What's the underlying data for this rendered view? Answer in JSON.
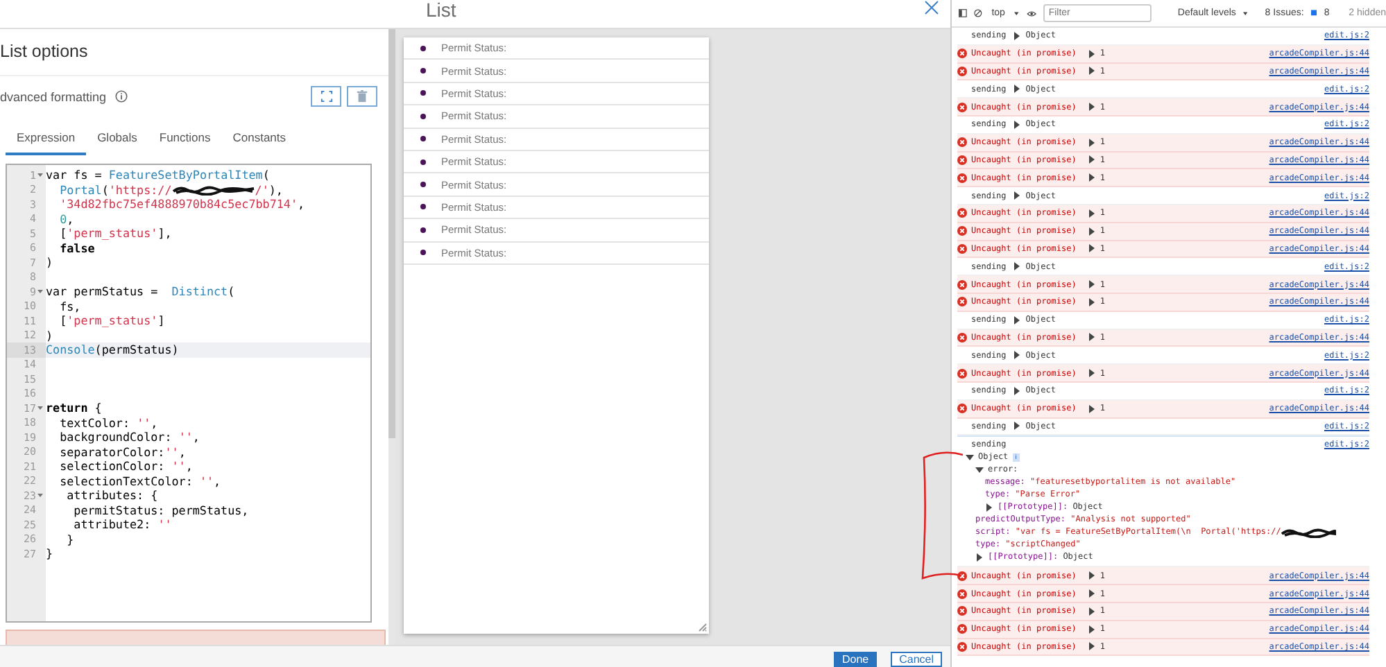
{
  "dialog": {
    "title": "List",
    "footer_buttons": [
      {
        "label": "Done",
        "kind": "primary"
      },
      {
        "label": "Cancel",
        "kind": "secondary"
      }
    ]
  },
  "options_panel": {
    "title": "List options",
    "section_label": "dvanced formatting",
    "tabs": [
      {
        "label": "Expression",
        "selected": true
      },
      {
        "label": "Globals",
        "selected": false
      },
      {
        "label": "Functions",
        "selected": false
      },
      {
        "label": "Constants",
        "selected": false
      }
    ]
  },
  "editor": {
    "lines": [
      {
        "number": "1",
        "foldable": true,
        "current": false,
        "tokens": [
          {
            "text": "var fs = ",
            "kind": "plain"
          },
          {
            "text": "FeatureSetByPortalItem",
            "kind": "function"
          },
          {
            "text": "(",
            "kind": "plain"
          }
        ]
      },
      {
        "number": "2",
        "foldable": false,
        "current": false,
        "tokens": [
          {
            "text": "  Portal",
            "kind": "function"
          },
          {
            "text": "(",
            "kind": "plain"
          },
          {
            "text": "'https://",
            "kind": "string"
          },
          {
            "kind": "redaction"
          },
          {
            "text": "/'",
            "kind": "string"
          },
          {
            "text": "),",
            "kind": "plain"
          }
        ]
      },
      {
        "number": "3",
        "foldable": false,
        "current": false,
        "tokens": [
          {
            "text": "  '34d82fbc75ef4888970b84c5ec7bb714'",
            "kind": "string"
          },
          {
            "text": ",",
            "kind": "plain"
          }
        ]
      },
      {
        "number": "4",
        "foldable": false,
        "current": false,
        "tokens": [
          {
            "text": "  0",
            "kind": "number"
          },
          {
            "text": ",",
            "kind": "plain"
          }
        ]
      },
      {
        "number": "5",
        "foldable": false,
        "current": false,
        "tokens": [
          {
            "text": "  [",
            "kind": "plain"
          },
          {
            "text": "'perm_status'",
            "kind": "string"
          },
          {
            "text": "],",
            "kind": "plain"
          }
        ]
      },
      {
        "number": "6",
        "foldable": false,
        "current": false,
        "tokens": [
          {
            "text": "  false",
            "kind": "keyword"
          }
        ]
      },
      {
        "number": "7",
        "foldable": false,
        "current": false,
        "tokens": [
          {
            "text": ")",
            "kind": "plain"
          }
        ]
      },
      {
        "number": "8",
        "foldable": false,
        "current": false
      },
      {
        "number": "9",
        "foldable": true,
        "current": false,
        "tokens": [
          {
            "text": "var permStatus =  ",
            "kind": "plain"
          },
          {
            "text": "Distinct",
            "kind": "function"
          },
          {
            "text": "(",
            "kind": "plain"
          }
        ]
      },
      {
        "number": "10",
        "foldable": false,
        "current": false,
        "tokens": [
          {
            "text": "  fs,",
            "kind": "plain"
          }
        ]
      },
      {
        "number": "11",
        "foldable": false,
        "current": false,
        "tokens": [
          {
            "text": "  [",
            "kind": "plain"
          },
          {
            "text": "'perm_status'",
            "kind": "string"
          },
          {
            "text": "]",
            "kind": "plain"
          }
        ]
      },
      {
        "number": "12",
        "foldable": false,
        "current": false,
        "tokens": [
          {
            "text": ")",
            "kind": "plain"
          }
        ]
      },
      {
        "number": "13",
        "foldable": false,
        "current": true,
        "tokens": [
          {
            "text": "Console",
            "kind": "function"
          },
          {
            "text": "(permStatus)",
            "kind": "plain"
          }
        ]
      },
      {
        "number": "14",
        "foldable": false,
        "current": false
      },
      {
        "number": "15",
        "foldable": false,
        "current": false
      },
      {
        "number": "16",
        "foldable": false,
        "current": false
      },
      {
        "number": "17",
        "foldable": true,
        "current": false,
        "tokens": [
          {
            "text": "return",
            "kind": "keyword"
          },
          {
            "text": " {",
            "kind": "plain"
          }
        ]
      },
      {
        "number": "18",
        "foldable": false,
        "current": false,
        "tokens": [
          {
            "text": "  textColor: ",
            "kind": "plain"
          },
          {
            "text": "''",
            "kind": "string"
          },
          {
            "text": ",",
            "kind": "plain"
          }
        ]
      },
      {
        "number": "19",
        "foldable": false,
        "current": false,
        "tokens": [
          {
            "text": "  backgroundColor: ",
            "kind": "plain"
          },
          {
            "text": "''",
            "kind": "string"
          },
          {
            "text": ",",
            "kind": "plain"
          }
        ]
      },
      {
        "number": "20",
        "foldable": false,
        "current": false,
        "tokens": [
          {
            "text": "  separatorColor:",
            "kind": "plain"
          },
          {
            "text": "''",
            "kind": "string"
          },
          {
            "text": ",",
            "kind": "plain"
          }
        ]
      },
      {
        "number": "21",
        "foldable": false,
        "current": false,
        "tokens": [
          {
            "text": "  selectionColor: ",
            "kind": "plain"
          },
          {
            "text": "''",
            "kind": "string"
          },
          {
            "text": ",",
            "kind": "plain"
          }
        ]
      },
      {
        "number": "22",
        "foldable": false,
        "current": false,
        "tokens": [
          {
            "text": "  selectionTextColor: ",
            "kind": "plain"
          },
          {
            "text": "''",
            "kind": "string"
          },
          {
            "text": ",",
            "kind": "plain"
          }
        ]
      },
      {
        "number": "23",
        "foldable": true,
        "current": false,
        "tokens": [
          {
            "text": "   attributes: {",
            "kind": "plain"
          }
        ]
      },
      {
        "number": "24",
        "foldable": false,
        "current": false,
        "tokens": [
          {
            "text": "    permitStatus: permStatus,",
            "kind": "plain"
          }
        ]
      },
      {
        "number": "25",
        "foldable": false,
        "current": false,
        "tokens": [
          {
            "text": "    attribute2: ",
            "kind": "plain"
          },
          {
            "text": "''",
            "kind": "string"
          }
        ]
      },
      {
        "number": "26",
        "foldable": false,
        "current": false,
        "tokens": [
          {
            "text": "   }",
            "kind": "plain"
          }
        ]
      },
      {
        "number": "27",
        "foldable": false,
        "current": false,
        "tokens": [
          {
            "text": "}",
            "kind": "plain"
          }
        ]
      }
    ]
  },
  "preview_list": {
    "items": [
      {
        "label": "Permit Status:"
      },
      {
        "label": "Permit Status:"
      },
      {
        "label": "Permit Status:"
      },
      {
        "label": "Permit Status:"
      },
      {
        "label": "Permit Status:"
      },
      {
        "label": "Permit Status:"
      },
      {
        "label": "Permit Status:"
      },
      {
        "label": "Permit Status:"
      },
      {
        "label": "Permit Status:"
      },
      {
        "label": "Permit Status:"
      }
    ]
  },
  "devtools": {
    "toolbar": {
      "context": "top",
      "filter_placeholder": "Filter",
      "levels": "Default levels",
      "issues_label": "8 Issues:",
      "issues_count": "8",
      "hidden": "2 hidden"
    },
    "console": [
      {
        "kind": "log",
        "text": "sending",
        "value": "Object",
        "source": "edit.js:2"
      },
      {
        "kind": "error",
        "text": "Uncaught (in promise)",
        "value": "1",
        "source": "arcadeCompiler.js:44"
      },
      {
        "kind": "error",
        "text": "Uncaught (in promise)",
        "value": "1",
        "source": "arcadeCompiler.js:44"
      },
      {
        "kind": "log",
        "text": "sending",
        "value": "Object",
        "source": "edit.js:2"
      },
      {
        "kind": "error",
        "text": "Uncaught (in promise)",
        "value": "1",
        "source": "arcadeCompiler.js:44"
      },
      {
        "kind": "log",
        "text": "sending",
        "value": "Object",
        "source": "edit.js:2"
      },
      {
        "kind": "error",
        "text": "Uncaught (in promise)",
        "value": "1",
        "source": "arcadeCompiler.js:44"
      },
      {
        "kind": "error",
        "text": "Uncaught (in promise)",
        "value": "1",
        "source": "arcadeCompiler.js:44"
      },
      {
        "kind": "error",
        "text": "Uncaught (in promise)",
        "value": "1",
        "source": "arcadeCompiler.js:44"
      },
      {
        "kind": "log",
        "text": "sending",
        "value": "Object",
        "source": "edit.js:2"
      },
      {
        "kind": "error",
        "text": "Uncaught (in promise)",
        "value": "1",
        "source": "arcadeCompiler.js:44"
      },
      {
        "kind": "error",
        "text": "Uncaught (in promise)",
        "value": "1",
        "source": "arcadeCompiler.js:44"
      },
      {
        "kind": "error",
        "text": "Uncaught (in promise)",
        "value": "1",
        "source": "arcadeCompiler.js:44"
      },
      {
        "kind": "log",
        "text": "sending",
        "value": "Object",
        "source": "edit.js:2"
      },
      {
        "kind": "error",
        "text": "Uncaught (in promise)",
        "value": "1",
        "source": "arcadeCompiler.js:44"
      },
      {
        "kind": "error",
        "text": "Uncaught (in promise)",
        "value": "1",
        "source": "arcadeCompiler.js:44"
      },
      {
        "kind": "log",
        "text": "sending",
        "value": "Object",
        "source": "edit.js:2"
      },
      {
        "kind": "error",
        "text": "Uncaught (in promise)",
        "value": "1",
        "source": "arcadeCompiler.js:44"
      },
      {
        "kind": "log",
        "text": "sending",
        "value": "Object",
        "source": "edit.js:2"
      },
      {
        "kind": "error",
        "text": "Uncaught (in promise)",
        "value": "1",
        "source": "arcadeCompiler.js:44"
      },
      {
        "kind": "log",
        "text": "sending",
        "value": "Object",
        "source": "edit.js:2"
      },
      {
        "kind": "error",
        "text": "Uncaught (in promise)",
        "value": "1",
        "source": "arcadeCompiler.js:44"
      },
      {
        "kind": "log",
        "text": "sending",
        "value": "Object",
        "source": "edit.js:2"
      },
      {
        "kind": "expanded",
        "text": "sending",
        "source": "edit.js:2",
        "tree": {
          "key": "Object",
          "badge": "i",
          "expanded": true,
          "children": [
            {
              "key": "error:",
              "expanded": true,
              "children": [
                {
                  "key": "message:",
                  "value": "\"featuresetbyportalitem is not available\"",
                  "kind": "string"
                },
                {
                  "key": "type:",
                  "value": "\"Parse Error\"",
                  "kind": "string"
                },
                {
                  "key": "[[Prototype]]:",
                  "value": "Object",
                  "kind": "plain",
                  "expanded": false
                }
              ]
            },
            {
              "key": "predictOutputType:",
              "value": "\"Analysis not supported\"",
              "kind": "string"
            },
            {
              "key": "script:",
              "value": "\"var fs = FeatureSetByPortalItem(\\n  Portal('https://",
              "kind": "string",
              "redacted": true
            },
            {
              "key": "type:",
              "value": "\"scriptChanged\"",
              "kind": "string"
            },
            {
              "key": "[[Prototype]]:",
              "value": "Object",
              "kind": "plain",
              "expanded": false
            }
          ]
        }
      },
      {
        "kind": "error",
        "text": "Uncaught (in promise)",
        "value": "1",
        "source": "arcadeCompiler.js:44"
      },
      {
        "kind": "error",
        "text": "Uncaught (in promise)",
        "value": "1",
        "source": "arcadeCompiler.js:44"
      },
      {
        "kind": "error",
        "text": "Uncaught (in promise)",
        "value": "1",
        "source": "arcadeCompiler.js:44"
      },
      {
        "kind": "error",
        "text": "Uncaught (in promise)",
        "value": "1",
        "source": "arcadeCompiler.js:44"
      },
      {
        "kind": "error",
        "text": "Uncaught (in promise)",
        "value": "1",
        "source": "arcadeCompiler.js:44"
      }
    ]
  }
}
